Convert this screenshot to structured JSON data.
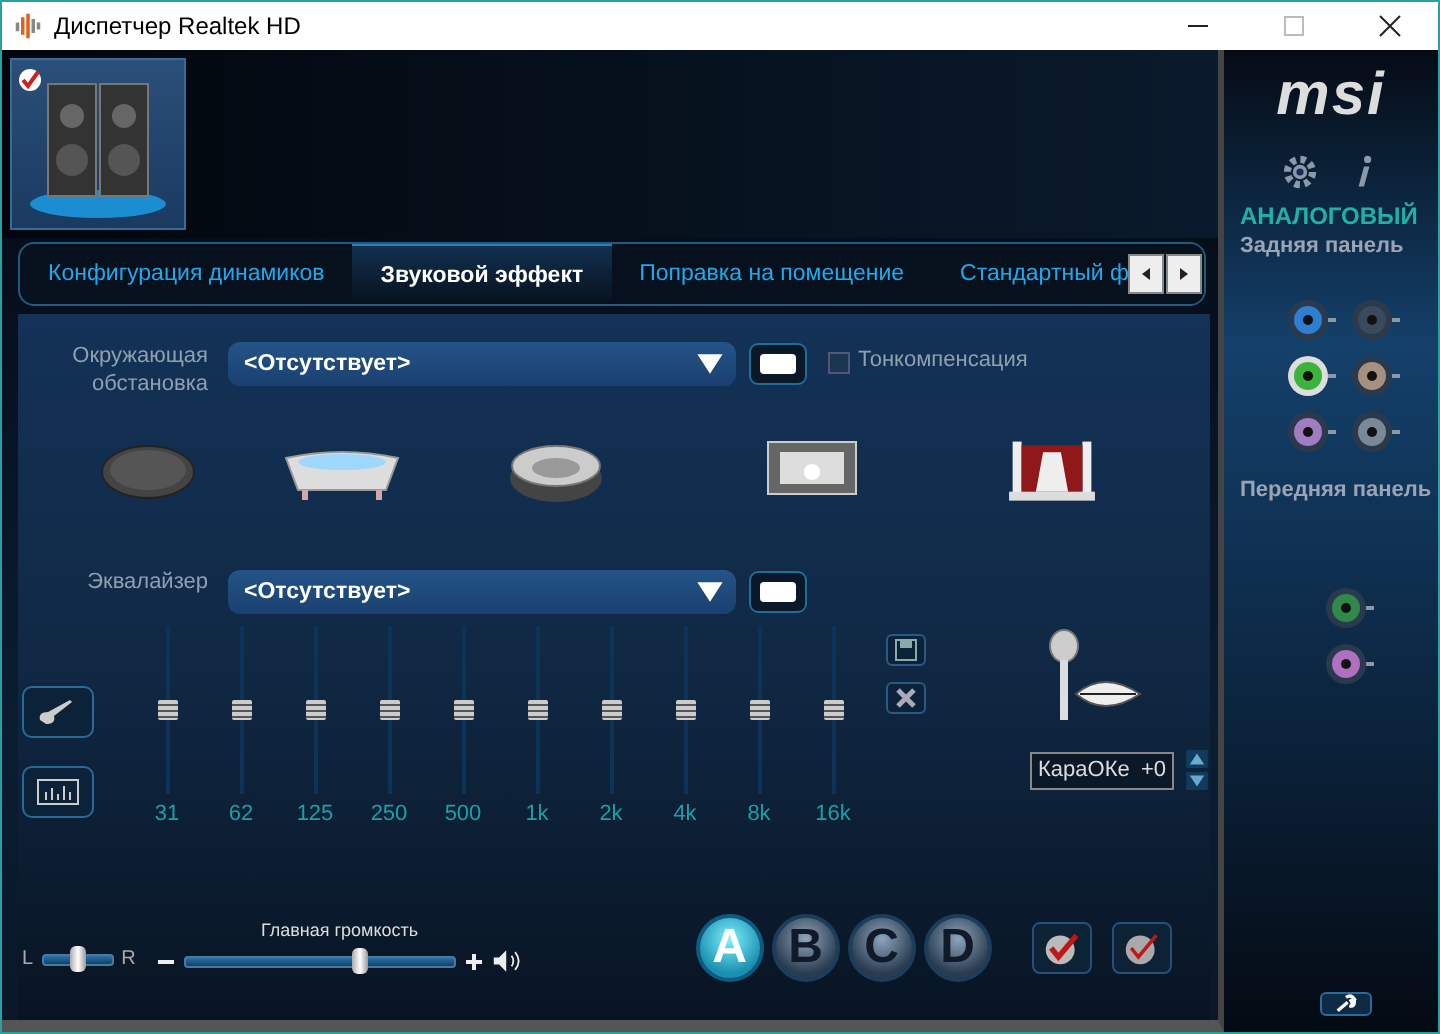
{
  "window": {
    "title": "Диспетчер Realtek HD"
  },
  "device": {
    "default": true
  },
  "tabs": [
    {
      "label": "Конфигурация динамиков",
      "selected": false
    },
    {
      "label": "Звуковой эффект",
      "selected": true
    },
    {
      "label": "Поправка на помещение",
      "selected": false
    },
    {
      "label": "Стандартный ф",
      "selected": false
    }
  ],
  "environment": {
    "label": "Окружающая обстановка",
    "value": "<Отсутствует>",
    "loudness": {
      "label": "Тонкомпенсация",
      "checked": false
    }
  },
  "equalizer": {
    "label": "Эквалайзер",
    "value": "<Отсутствует>",
    "bands": [
      {
        "label": "31",
        "level": 0.5
      },
      {
        "label": "62",
        "level": 0.5
      },
      {
        "label": "125",
        "level": 0.5
      },
      {
        "label": "250",
        "level": 0.5
      },
      {
        "label": "500",
        "level": 0.5
      },
      {
        "label": "1k",
        "level": 0.5
      },
      {
        "label": "2k",
        "level": 0.5
      },
      {
        "label": "4k",
        "level": 0.5
      },
      {
        "label": "8k",
        "level": 0.5
      },
      {
        "label": "16k",
        "level": 0.5
      }
    ]
  },
  "karaoke": {
    "label": "КараОКе",
    "value": "+0"
  },
  "volume": {
    "label": "Главная громкость",
    "left": "L",
    "right": "R",
    "balance": {
      "level": 0.5
    },
    "main": {
      "level": 0.66
    }
  },
  "formats": [
    {
      "label": "A",
      "selected": true
    },
    {
      "label": "B",
      "selected": false
    },
    {
      "label": "C",
      "selected": false
    },
    {
      "label": "D",
      "selected": false
    }
  ],
  "sidebar": {
    "logo": "msi",
    "mode": "АНАЛОГОВЫЙ",
    "rear_label": "Задняя панель",
    "rear_jacks": [
      {
        "color": "#2f7fd0",
        "plugged": false
      },
      {
        "color": "#3a4a5c",
        "plugged": false
      },
      {
        "color": "#3cb43c",
        "plugged": true
      },
      {
        "color": "#a89080",
        "plugged": false
      },
      {
        "color": "#a07cc0",
        "plugged": false
      },
      {
        "color": "#7a8898",
        "plugged": false
      }
    ],
    "front_label": "Передняя панель",
    "front_jacks": [
      {
        "color": "#2f8a4a",
        "plugged": false
      },
      {
        "color": "#b070c0",
        "plugged": false
      }
    ]
  }
}
